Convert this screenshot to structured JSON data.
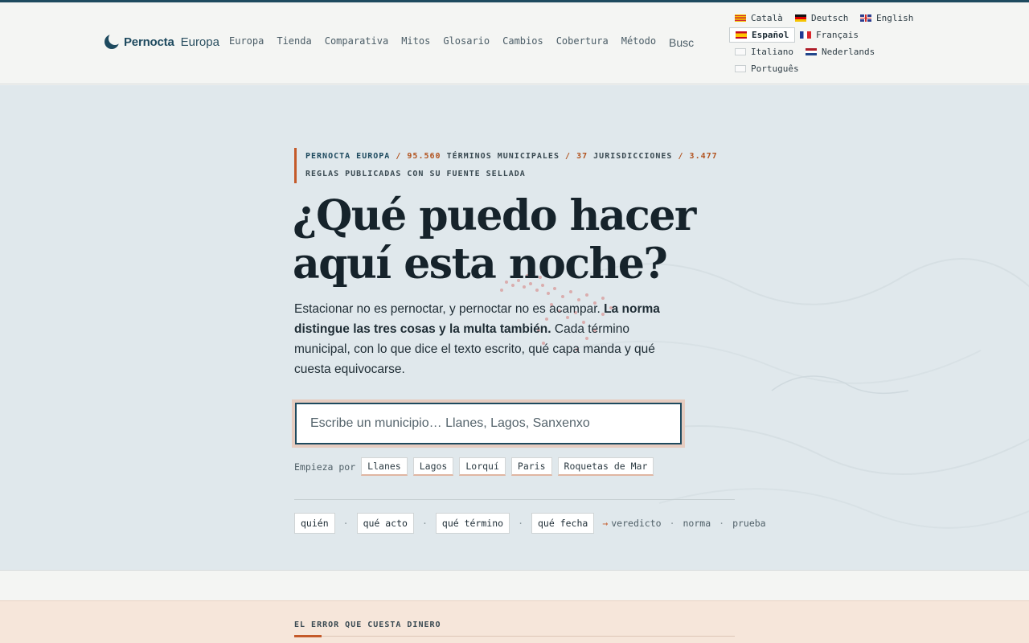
{
  "brand": {
    "name": "Pernocta",
    "sub": "Europa"
  },
  "nav": [
    "Europa",
    "Tienda",
    "Comparativa",
    "Mitos",
    "Glosario",
    "Cambios",
    "Cobertura",
    "Método"
  ],
  "search_stub": "Busc",
  "languages": [
    {
      "label": "Català",
      "flag": "ca-flag"
    },
    {
      "label": "Deutsch",
      "flag": "de-flag"
    },
    {
      "label": "English",
      "flag": "gb-flag"
    },
    {
      "label": "Español",
      "flag": "es-flag",
      "active": true
    },
    {
      "label": "Français",
      "flag": "fr-flag"
    },
    {
      "label": "Italiano",
      "flag": "it-flag"
    },
    {
      "label": "Nederlands",
      "flag": "nl-flag"
    },
    {
      "label": "Português",
      "flag": "pt-flag"
    }
  ],
  "hero": {
    "kicker": {
      "brand": "PERNOCTA EUROPA",
      "sep": "/",
      "count1": "95.560",
      "text1": "TÉRMINOS MUNICIPALES",
      "count2": "37",
      "text2": "JURISDICCIONES",
      "count3": "3.477",
      "text3": "REGLAS PUBLICADAS CON SU FUENTE SELLADA"
    },
    "headline_1": "¿Qué puedo hacer",
    "headline_2": "aquí esta noche?",
    "lead_1": "Estacionar no es pernoctar, y pernoctar no es acampar.",
    "lead_bold": "La norma distingue las tres cosas y la multa también.",
    "lead_2": "Cada término municipal, con lo que dice el texto escrito, qué capa manda y qué cuesta equivocarse.",
    "search_placeholder": "Escribe un municipio… Llanes, Lagos, Sanxenxo",
    "start_label": "Empieza por",
    "start_chips": [
      "Llanes",
      "Lagos",
      "Lorquí",
      "Paris",
      "Roquetas de Mar"
    ],
    "flow_steps": [
      "quién",
      "qué acto",
      "qué término",
      "qué fecha"
    ],
    "flow_arrow": "→",
    "flow_results": [
      "veredicto",
      "norma",
      "prueba"
    ],
    "flow_dot": "·"
  },
  "warning": {
    "title": "EL ERROR QUE CUESTA DINERO"
  },
  "colors": {
    "brand": "#1e4a5f",
    "accent": "#c45a2a"
  }
}
